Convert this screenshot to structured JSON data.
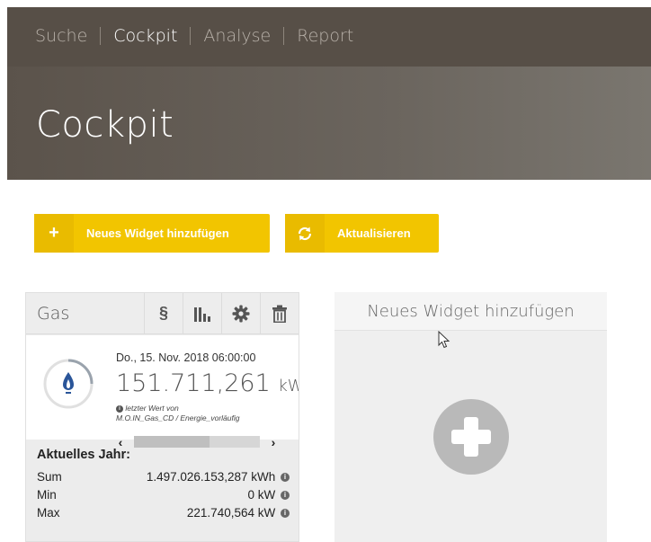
{
  "nav": {
    "items": [
      {
        "label": "Suche",
        "active": false
      },
      {
        "label": "Cockpit",
        "active": true
      },
      {
        "label": "Analyse",
        "active": false
      },
      {
        "label": "Report",
        "active": false
      }
    ]
  },
  "hero": {
    "title": "Cockpit"
  },
  "actions": {
    "add_widget": {
      "icon": "+",
      "label": "Neues Widget hinzufügen"
    },
    "refresh": {
      "icon": "refresh-icon",
      "label": "Aktualisieren"
    }
  },
  "widget": {
    "title": "Gas",
    "tools": {
      "paragraph": "§",
      "chart": "bar-chart-icon",
      "settings": "gear-icon",
      "delete": "trash-icon"
    },
    "date": "Do., 15. Nov. 2018 06:00:00",
    "value": "151.711,261",
    "unit": "kWh",
    "note_line1": "letzter Wert von",
    "note_line2": "M.O.IN_Gas_CD / Energie_vorläufig",
    "scroll_left": "‹",
    "scroll_right": "›",
    "stats_heading": "Aktuelles Jahr:",
    "stats": [
      {
        "label": "Sum",
        "value": "1.497.026.153,287 kWh"
      },
      {
        "label": "Min",
        "value": "0 kW"
      },
      {
        "label": "Max",
        "value": "221.740,564 kW"
      }
    ]
  },
  "new_widget": {
    "title": "Neues Widget hinzufügen"
  },
  "colors": {
    "accent": "#f2c500",
    "topbar": "#574f47",
    "flame": "#2a5599"
  }
}
